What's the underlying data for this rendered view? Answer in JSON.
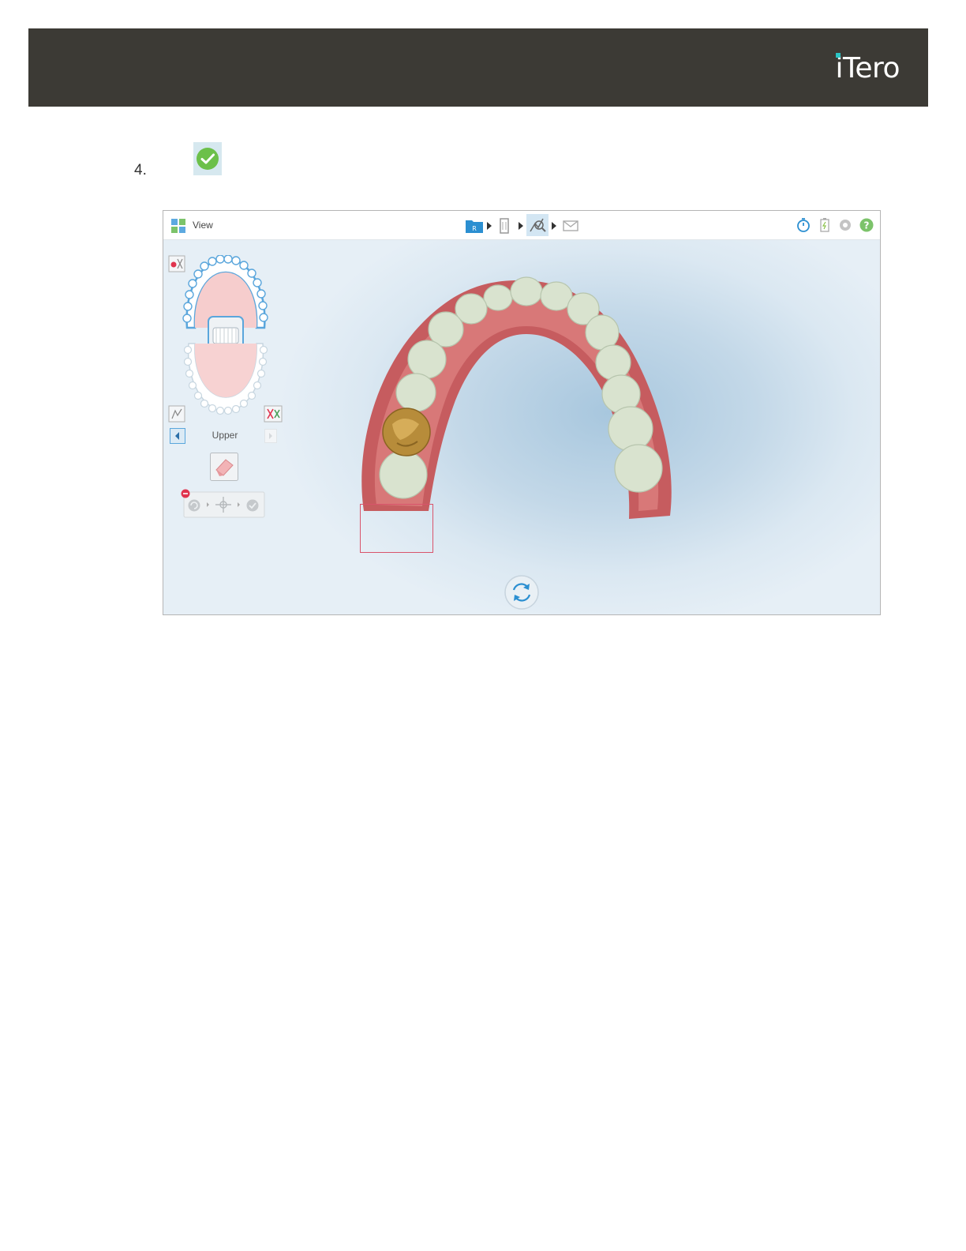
{
  "header": {
    "logo_text": "iTero"
  },
  "step": {
    "number": "4."
  },
  "screenshot": {
    "toolbar": {
      "view_label": "View"
    },
    "arch_label": "Upper"
  },
  "colors": {
    "header_bg": "#3c3a35",
    "logo_accent": "#2bc4c4",
    "check_green": "#6cc04a",
    "selection_red": "#d9546b",
    "toolbar_blue": "#2b8fd1"
  }
}
